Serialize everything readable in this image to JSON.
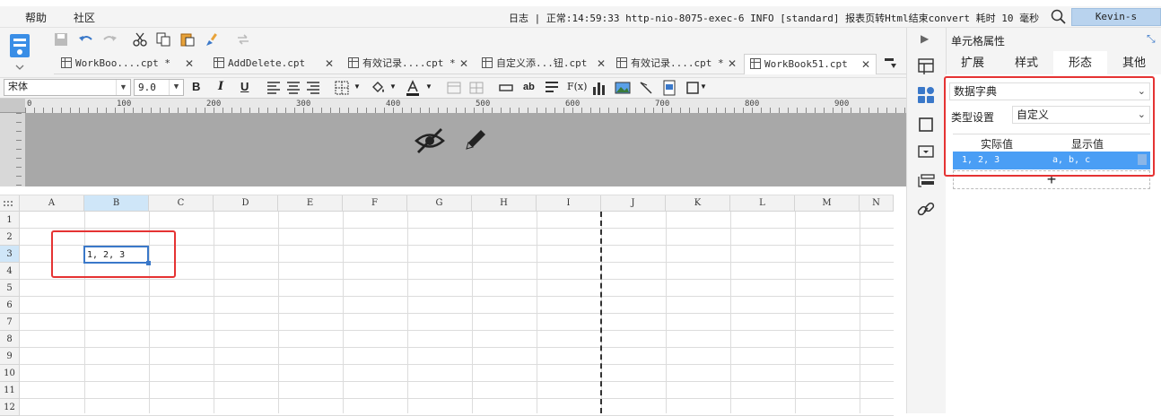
{
  "menubar": {
    "help": "帮助",
    "community": "社区",
    "log": "日志 | 正常:14:59:33 http-nio-8075-exec-6 INFO [standard] 报表页转Html结束convert  耗时 10 毫秒",
    "user": "Kevin-s"
  },
  "tabs": [
    {
      "label": "WorkBoo....cpt *"
    },
    {
      "label": "AddDelete.cpt"
    },
    {
      "label": "有效记录....cpt *"
    },
    {
      "label": "自定义添...钮.cpt"
    },
    {
      "label": "有效记录....cpt *"
    },
    {
      "label": "WorkBook51.cpt"
    }
  ],
  "format": {
    "font": "宋体",
    "size": "9.0",
    "bold": "B",
    "italic": "I",
    "underline": "U",
    "ab_label": "ab",
    "fx_label": "F(x)"
  },
  "ruler": [
    "0",
    "100",
    "200",
    "300",
    "400",
    "500",
    "600",
    "700",
    "800",
    "900"
  ],
  "columns": [
    "A",
    "B",
    "C",
    "D",
    "E",
    "F",
    "G",
    "H",
    "I",
    "J",
    "K",
    "L",
    "M",
    "N"
  ],
  "rows": [
    "1",
    "2",
    "3",
    "4",
    "5",
    "6",
    "7",
    "8",
    "9",
    "10",
    "11",
    "12"
  ],
  "cell_b3": "1, 2, 3",
  "panel": {
    "title": "单元格属性",
    "tabs": [
      "扩展",
      "样式",
      "形态",
      "其他"
    ],
    "dict_type": "数据字典",
    "type_label": "类型设置",
    "type_value": "自定义",
    "col_actual": "实际值",
    "col_display": "显示值",
    "row_actual": "1, 2, 3",
    "row_display": "a, b, c",
    "add": "+"
  },
  "colors": {
    "accent": "#3a78c9",
    "highlight": "#4a9ef5",
    "annotation": "#e53333"
  }
}
